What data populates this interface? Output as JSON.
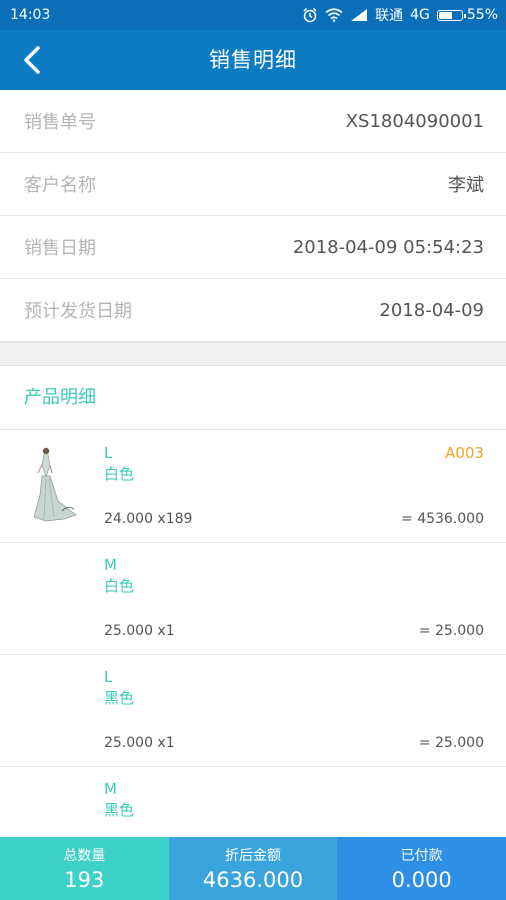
{
  "status_bar": {
    "time": "14:03",
    "carrier": "联通",
    "network": "4G",
    "battery": "55%",
    "battery_level": 0.55
  },
  "nav": {
    "title": "销售明细",
    "back_icon": "chevron-left-icon"
  },
  "info": [
    {
      "label": "销售单号",
      "value": "XS1804090001"
    },
    {
      "label": "客户名称",
      "value": "李斌"
    },
    {
      "label": "销售日期",
      "value": "2018-04-09 05:54:23"
    },
    {
      "label": "预计发货日期",
      "value": "2018-04-09"
    }
  ],
  "section_title": "产品明细",
  "products": [
    {
      "size": "L",
      "color": "白色",
      "code": "A003",
      "qty": "24.000 x189",
      "total": "= 4536.000",
      "has_image": true
    },
    {
      "size": "M",
      "color": "白色",
      "code": "",
      "qty": "25.000 x1",
      "total": "= 25.000",
      "has_image": false
    },
    {
      "size": "L",
      "color": "黑色",
      "code": "",
      "qty": "25.000 x1",
      "total": "= 25.000",
      "has_image": false
    },
    {
      "size": "M",
      "color": "黑色",
      "code": "",
      "qty": "",
      "total": "",
      "has_image": false
    }
  ],
  "footer": {
    "qty_label": "总数量",
    "qty_value": "193",
    "amount_label": "折后金额",
    "amount_value": "4636.000",
    "paid_label": "已付款",
    "paid_value": "0.000"
  },
  "colors": {
    "nav": "#0b7cc4",
    "status": "#0a6fb8",
    "accent_teal": "#3ec9b8",
    "code_orange": "#f0a22a",
    "footer_qty": "#3ed1c9",
    "footer_amount": "#3aa5dc",
    "footer_paid": "#2f8fe6"
  }
}
